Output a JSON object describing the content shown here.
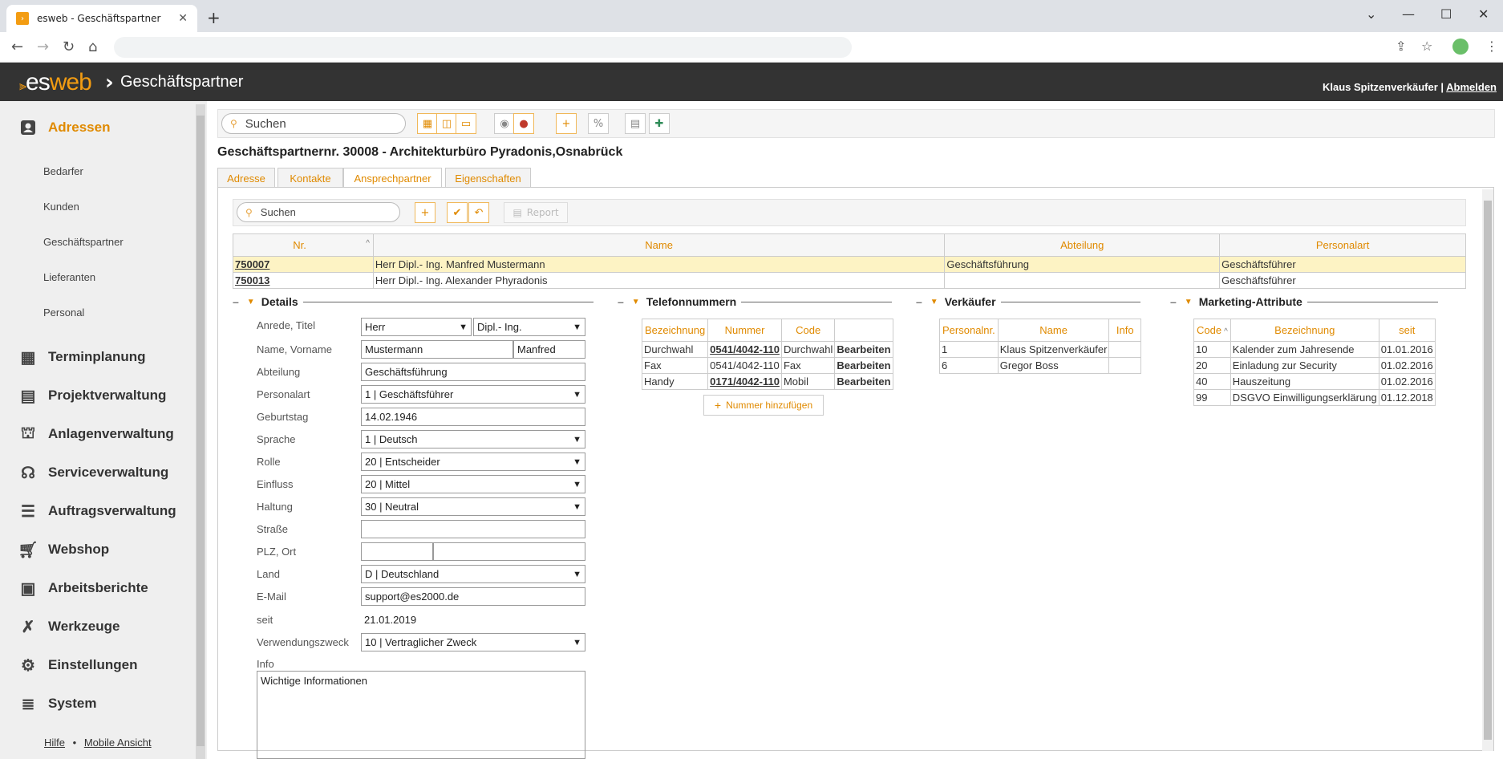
{
  "browser": {
    "tab_title": "esweb - Geschäftspartner",
    "tab_close": "✕",
    "new_tab": "+",
    "win_min": "⌄",
    "win_min2": "—",
    "win_max": "☐",
    "win_close": "✕"
  },
  "header": {
    "logo_es": "es",
    "logo_web": "web",
    "logo_chev": "›",
    "title": "Geschäftspartner",
    "user": "Klaus Spitzenverkäufer",
    "separator": " | ",
    "logout": "Abmelden"
  },
  "sidebar": {
    "active": "Adressen",
    "subitems": [
      "Bedarfer",
      "Kunden",
      "Geschäftspartner",
      "Lieferanten",
      "Personal"
    ],
    "items": [
      "Terminplanung",
      "Projektverwaltung",
      "Anlagenverwaltung",
      "Serviceverwaltung",
      "Auftragsverwaltung",
      "Webshop",
      "Arbeitsberichte",
      "Werkzeuge",
      "Einstellungen",
      "System"
    ],
    "footer_help": "Hilfe",
    "footer_sep": "•",
    "footer_mobile": "Mobile Ansicht"
  },
  "toolbar": {
    "search_placeholder": "Suchen"
  },
  "record": {
    "title": "Geschäftspartnernr. 30008 - Architekturbüro Pyradonis,Osnabrück"
  },
  "tabs": [
    "Adresse",
    "Kontakte",
    "Ansprechpartner",
    "Eigenschaften"
  ],
  "subtoolbar": {
    "search_placeholder": "Suchen",
    "report": "Report"
  },
  "contacts": {
    "headers": [
      "Nr.",
      "Name",
      "Abteilung",
      "Personalart"
    ],
    "sort_indicator": "^",
    "rows": [
      {
        "nr": "750007",
        "name": "Herr Dipl.- Ing. Manfred Mustermann",
        "abteilung": "Geschäftsführung",
        "personalart": "Geschäftsführer"
      },
      {
        "nr": "750013",
        "name": "Herr Dipl.- Ing. Alexander Phyradonis",
        "abteilung": "",
        "personalart": "Geschäftsführer"
      }
    ]
  },
  "sections": {
    "details": "Details",
    "phones": "Telefonnummern",
    "sellers": "Verkäufer",
    "marketing": "Marketing-Attribute"
  },
  "details": {
    "labels": {
      "anrede": "Anrede, Titel",
      "name": "Name, Vorname",
      "abteilung": "Abteilung",
      "personalart": "Personalart",
      "geburtstag": "Geburtstag",
      "sprache": "Sprache",
      "rolle": "Rolle",
      "einfluss": "Einfluss",
      "haltung": "Haltung",
      "strasse": "Straße",
      "plz": "PLZ, Ort",
      "land": "Land",
      "email": "E-Mail",
      "seit": "seit",
      "zweck": "Verwendungszweck",
      "info": "Info"
    },
    "values": {
      "anrede": "Herr",
      "titel": "Dipl.- Ing.",
      "name": "Mustermann",
      "vorname": "Manfred",
      "abteilung": "Geschäftsführung",
      "personalart": "1 | Geschäftsführer",
      "geburtstag": "14.02.1946",
      "sprache": "1 | Deutsch",
      "rolle": "20 | Entscheider",
      "einfluss": "20 | Mittel",
      "haltung": "30 | Neutral",
      "strasse": "",
      "plz": "",
      "ort": "",
      "land": "D | Deutschland",
      "email": "support@es2000.de",
      "seit": "21.01.2019",
      "zweck": "10 | Vertraglicher Zweck",
      "info": "Wichtige Informationen"
    }
  },
  "phones": {
    "headers": [
      "Bezeichnung",
      "Nummer",
      "Code",
      ""
    ],
    "rows": [
      {
        "bez": "Durchwahl",
        "nummer": "0541/4042-110",
        "code": "Durchwahl",
        "action": "Bearbeiten"
      },
      {
        "bez": "Fax",
        "nummer": "0541/4042-110",
        "code": "Fax",
        "action": "Bearbeiten"
      },
      {
        "bez": "Handy",
        "nummer": "0171/4042-110",
        "code": "Mobil",
        "action": "Bearbeiten"
      }
    ],
    "add_button": "Nummer hinzufügen"
  },
  "sellers": {
    "headers": [
      "Personalnr.",
      "Name",
      "Info"
    ],
    "rows": [
      {
        "nr": "1",
        "name": "Klaus Spitzenverkäufer",
        "info": ""
      },
      {
        "nr": "6",
        "name": "Gregor Boss",
        "info": ""
      }
    ]
  },
  "marketing": {
    "headers": [
      "Code",
      "Bezeichnung",
      "seit"
    ],
    "sort_indicator": "^",
    "rows": [
      {
        "code": "10",
        "bez": "Kalender zum Jahresende",
        "seit": "01.01.2016"
      },
      {
        "code": "20",
        "bez": "Einladung zur Security",
        "seit": "01.02.2016"
      },
      {
        "code": "40",
        "bez": "Hauszeitung",
        "seit": "01.02.2016"
      },
      {
        "code": "99",
        "bez": "DSGVO Einwilligungserklärung",
        "seit": "01.12.2018"
      }
    ]
  },
  "colors": {
    "accent": "#e08a00",
    "header_bg": "#333333",
    "selected_row": "#fdf3c4"
  }
}
